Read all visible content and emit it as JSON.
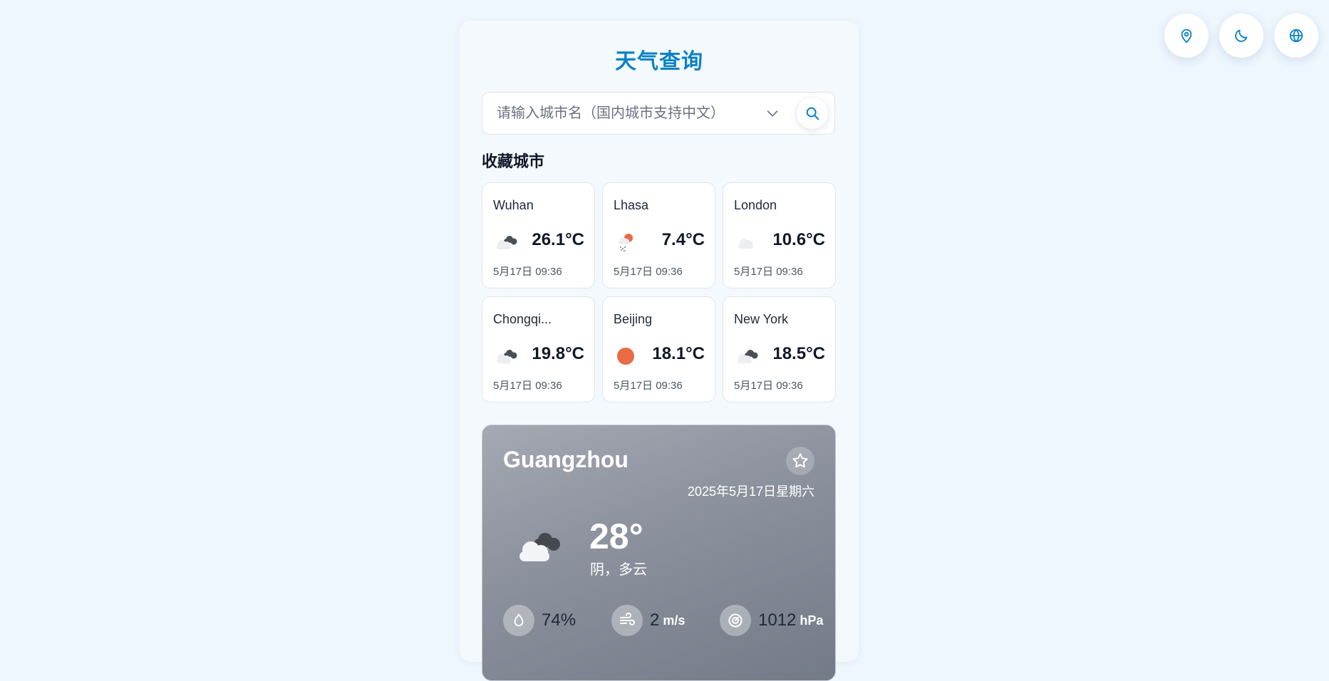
{
  "header": {
    "actions": [
      {
        "icon": "location-pin-icon"
      },
      {
        "icon": "moon-icon"
      },
      {
        "icon": "globe-icon"
      }
    ]
  },
  "app": {
    "title": "天气查询"
  },
  "search": {
    "placeholder": "请输入城市名（国内城市支持中文）",
    "value": ""
  },
  "favorites": {
    "title": "收藏城市",
    "cities": [
      {
        "name": "Wuhan",
        "temp": "26.1°C",
        "time": "5月17日 09:36",
        "icon": "overcast-cloud-icon"
      },
      {
        "name": "Lhasa",
        "temp": "7.4°C",
        "time": "5月17日 09:36",
        "icon": "sun-rain-icon"
      },
      {
        "name": "London",
        "temp": "10.6°C",
        "time": "5月17日 09:36",
        "icon": "cloud-icon"
      },
      {
        "name": "Chongqi...",
        "temp": "19.8°C",
        "time": "5月17日 09:36",
        "icon": "overcast-cloud-icon"
      },
      {
        "name": "Beijing",
        "temp": "18.1°C",
        "time": "5月17日 09:36",
        "icon": "sun-icon"
      },
      {
        "name": "New York",
        "temp": "18.5°C",
        "time": "5月17日 09:36",
        "icon": "overcast-cloud-icon"
      }
    ]
  },
  "current": {
    "city": "Guangzhou",
    "date": "2025年5月17日星期六",
    "temp": "28°",
    "condition": "阴，多云",
    "icon": "overcast-cloud-icon",
    "humidity": "74%",
    "wind": "2",
    "wind_unit": "m/s",
    "pressure": "1012",
    "pressure_unit": "hPa"
  },
  "colors": {
    "accent": "#0b82c6",
    "background": "#eef6fe",
    "sun": "#e96a45"
  }
}
